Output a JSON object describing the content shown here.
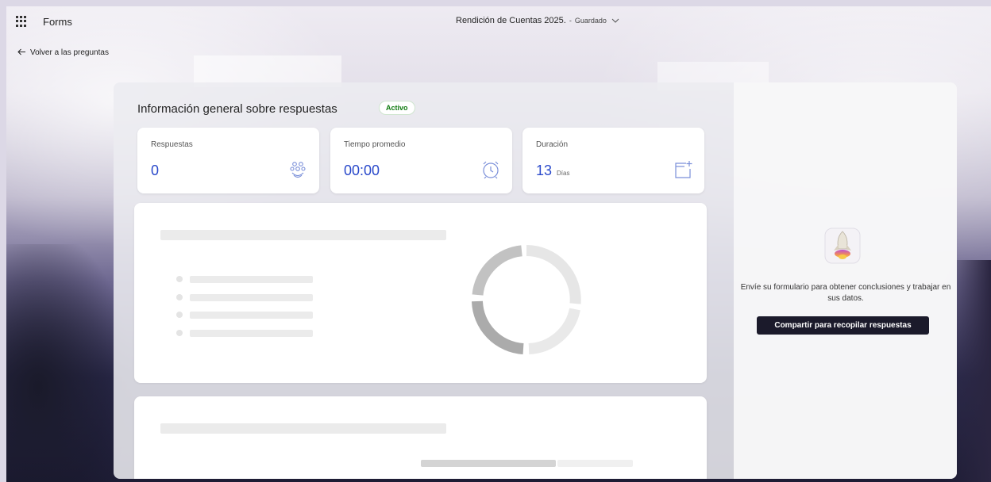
{
  "app": {
    "name": "Forms"
  },
  "header": {
    "doc_title": "Rendición de Cuentas 2025.",
    "separator": "-",
    "save_status": "Guardado"
  },
  "nav": {
    "back_label": "Volver a las preguntas"
  },
  "overview": {
    "title": "Información general sobre respuestas",
    "status_badge": "Activo",
    "stats": [
      {
        "label": "Respuestas",
        "value": "0",
        "unit": "",
        "icon": "people-icon"
      },
      {
        "label": "Tiempo promedio",
        "value": "00:00",
        "unit": "",
        "icon": "clock-icon"
      },
      {
        "label": "Duración",
        "value": "13",
        "unit": "Días",
        "icon": "calendar-icon"
      }
    ]
  },
  "side_panel": {
    "icon": "rocket-icon",
    "message": "Envíe su formulario para obtener conclusiones y trabajar en sus datos.",
    "share_button": "Compartir para recopilar respuestas"
  },
  "colors": {
    "accent_value": "#2b4acb",
    "active_badge": "#107c10",
    "share_button_bg": "#1b1a2b"
  }
}
